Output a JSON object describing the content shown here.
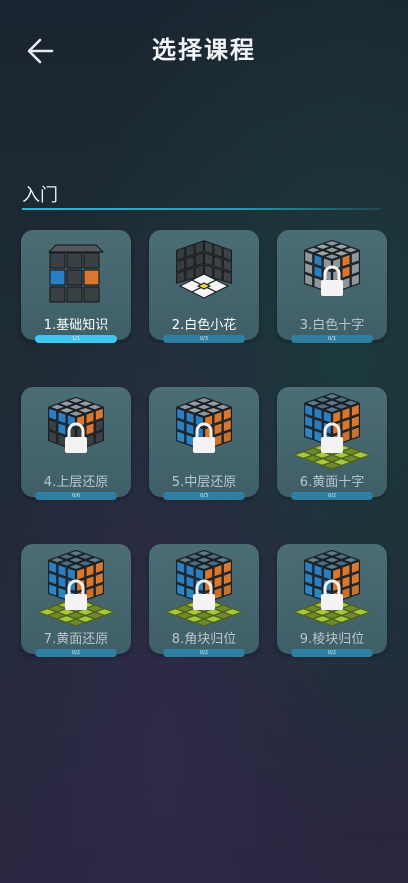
{
  "header": {
    "title": "选择课程"
  },
  "section": {
    "label": "入门"
  },
  "courses": [
    {
      "label": "1.基础知识",
      "progress": "1/1",
      "fraction": 1.0,
      "locked": false,
      "icon": "basics-cube-icon"
    },
    {
      "label": "2.白色小花",
      "progress": "0/3",
      "fraction": 0.0,
      "locked": false,
      "icon": "white-flower-cube-icon"
    },
    {
      "label": "3.白色十字",
      "progress": "0/1",
      "fraction": 0.0,
      "locked": true,
      "icon": "white-cross-cube-icon"
    },
    {
      "label": "4.上层还原",
      "progress": "0/6",
      "fraction": 0.0,
      "locked": true,
      "icon": "top-layer-cube-icon"
    },
    {
      "label": "5.中层还原",
      "progress": "0/3",
      "fraction": 0.0,
      "locked": true,
      "icon": "middle-layer-cube-icon"
    },
    {
      "label": "6.黄面十字",
      "progress": "0/2",
      "fraction": 0.0,
      "locked": true,
      "icon": "yellow-cross-cube-icon"
    },
    {
      "label": "7.黄面还原",
      "progress": "0/2",
      "fraction": 0.0,
      "locked": true,
      "icon": "yellow-face-cube-icon"
    },
    {
      "label": "8.角块归位",
      "progress": "0/2",
      "fraction": 0.0,
      "locked": true,
      "icon": "corner-position-cube-icon"
    },
    {
      "label": "9.棱块归位",
      "progress": "0/2",
      "fraction": 0.0,
      "locked": true,
      "icon": "edge-position-cube-icon"
    }
  ],
  "colors": {
    "accent": "#3ec6ee",
    "bar_bg": "#2f7fa3",
    "card": "#46666e"
  }
}
